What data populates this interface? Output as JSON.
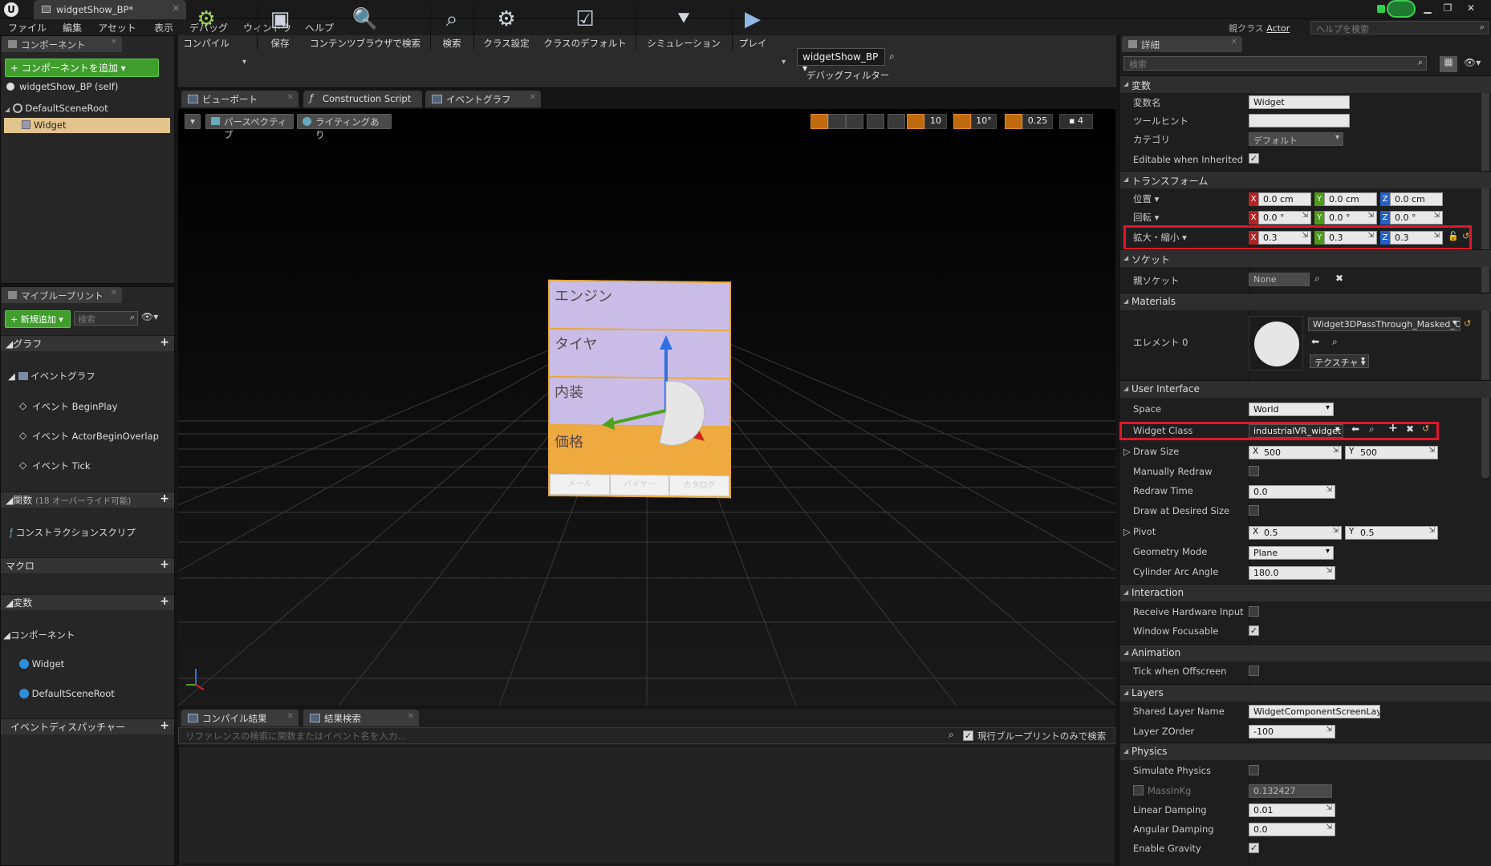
{
  "titlebar": {
    "tab_title": "widgetShow_BP*",
    "parent_class_label": "親クラス",
    "parent_class": "Actor",
    "help_placeholder": "ヘルプを検索"
  },
  "menu": [
    "ファイル",
    "編集",
    "アセット",
    "表示",
    "デバッグ",
    "ウィンドウ",
    "ヘルプ"
  ],
  "components": {
    "tab": "コンポーネント",
    "add_button": "+ コンポーネントを追加 ▾",
    "self_item": "widgetShow_BP (self)",
    "root": "DefaultSceneRoot",
    "child": "Widget"
  },
  "myblueprint": {
    "tab": "マイブループリント",
    "new_button": "+ 新規追加 ▾",
    "search_placeholder": "検索",
    "graphs_header": "グラフ",
    "event_graph": "イベントグラフ",
    "events": [
      "イベント BeginPlay",
      "イベント ActorBeginOverlap",
      "イベント Tick"
    ],
    "functions_header": "関数",
    "functions_note": "(18 オーバーライド可能)",
    "construction": "コンストラクションスクリプ",
    "macros_header": "マクロ",
    "variables_header": "変数",
    "components_header": "コンポーネント",
    "component_vars": [
      "Widget",
      "DefaultSceneRoot"
    ],
    "dispatchers_header": "イベントディスパッチャー"
  },
  "toolbar": {
    "compile": "コンパイル",
    "save": "保存",
    "browse": "コンテンツブラウザで検索",
    "find": "検索",
    "class_settings": "クラス設定",
    "class_defaults": "クラスのデフォルト",
    "simulation": "シミュレーション",
    "play": "プレイ",
    "debug_object": "widgetShow_BP ▾",
    "debug_filter": "デバッグフィルター"
  },
  "editor_tabs": [
    "ビューポート",
    "Construction Script",
    "イベントグラフ"
  ],
  "viewport": {
    "view_mode": "パースペクティブ",
    "lighting": "ライティングあり",
    "grid_snap": "10",
    "rot_snap": "10°",
    "scale_snap": "0.25",
    "cam_speed": "4",
    "widget_rows": [
      "エンジン",
      "タイヤ",
      "内装",
      "価格"
    ],
    "widget_buttons": [
      "メール",
      "バイヤー",
      "カタログ"
    ]
  },
  "bottom": {
    "tabs": [
      "コンパイル結果",
      "結果検索"
    ],
    "search_placeholder": "リファレンスの検索に関数またはイベント名を入力...",
    "only_current": "現行ブループリントのみで検索"
  },
  "details": {
    "tab": "詳細",
    "search_placeholder": "検索",
    "sections": {
      "variable": "変数",
      "transform": "トランスフォーム",
      "sockets": "ソケット",
      "materials": "Materials",
      "ui": "User Interface",
      "interaction": "Interaction",
      "animation": "Animation",
      "layers": "Layers",
      "physics": "Physics"
    },
    "variable": {
      "name_label": "変数名",
      "name": "Widget",
      "tooltip_label": "ツールヒント",
      "tooltip": "",
      "category_label": "カテゴリ",
      "category": "デフォルト",
      "editable_label": "Editable when Inherited",
      "editable": true
    },
    "transform": {
      "location_label": "位置 ▾",
      "location": [
        "0.0 cm",
        "0.0 cm",
        "0.0 cm"
      ],
      "rotation_label": "回転 ▾",
      "rotation": [
        "0.0 °",
        "0.0 °",
        "0.0 °"
      ],
      "scale_label": "拡大・縮小 ▾",
      "scale": [
        "0.3",
        "0.3",
        "0.3"
      ]
    },
    "sockets": {
      "parent_label": "親ソケット",
      "parent": "None"
    },
    "materials": {
      "element_label": "エレメント 0",
      "material": "Widget3DPassThrough_Masked_O",
      "texture_btn": "テクスチャ ▾"
    },
    "ui": {
      "space_label": "Space",
      "space": "World",
      "widget_class_label": "Widget Class",
      "widget_class": "industrialVR_widget",
      "draw_size_label": "Draw Size",
      "draw_size": [
        "500",
        "500"
      ],
      "manual_redraw_label": "Manually Redraw",
      "redraw_time_label": "Redraw Time",
      "redraw_time": "0.0",
      "draw_desired_label": "Draw at Desired Size",
      "pivot_label": "Pivot",
      "pivot": [
        "0.5",
        "0.5"
      ],
      "geometry_label": "Geometry Mode",
      "geometry": "Plane",
      "arc_label": "Cylinder Arc Angle",
      "arc": "180.0"
    },
    "interaction": {
      "hw_input_label": "Receive Hardware Input",
      "focusable_label": "Window Focusable"
    },
    "animation": {
      "tick_label": "Tick when Offscreen"
    },
    "layers": {
      "shared_label": "Shared Layer Name",
      "shared": "WidgetComponentScreenLayer",
      "zorder_label": "Layer ZOrder",
      "zorder": "-100"
    },
    "physics": {
      "simulate_label": "Simulate Physics",
      "mass_label": "MassInKg",
      "mass": "0.132427",
      "linear_label": "Linear Damping",
      "linear": "0.01",
      "angular_label": "Angular Damping",
      "angular": "0.0",
      "gravity_label": "Enable Gravity"
    }
  },
  "axis_labels": [
    "X",
    "Y",
    "Z"
  ],
  "colors": {
    "accent_green": "#3f9e2c",
    "highlight_red": "#e0162c",
    "widget_orange": "#e8a93a",
    "widget_lilac": "#c9bde8"
  }
}
